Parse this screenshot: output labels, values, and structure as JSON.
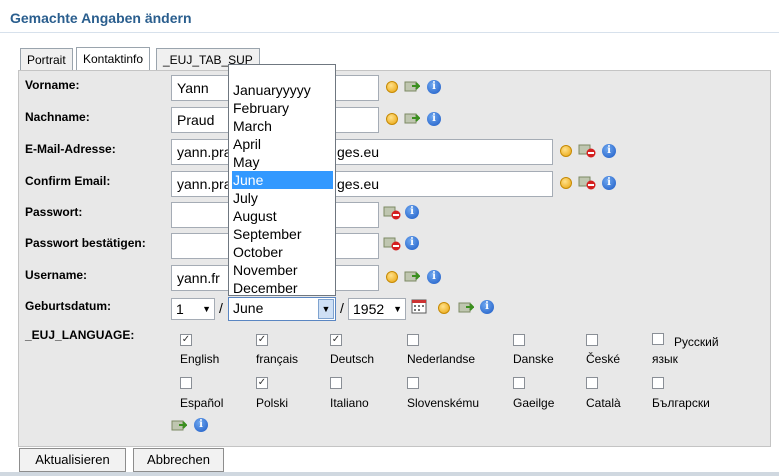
{
  "page": {
    "title": "Gemachte Angaben ändern"
  },
  "tabs": [
    {
      "label": "Portrait"
    },
    {
      "label": "Kontaktinfo"
    },
    {
      "label": "_EUJ_TAB_SUP"
    }
  ],
  "form": {
    "vorname": {
      "label": "Vorname:",
      "value": "Yann"
    },
    "nachname": {
      "label": "Nachname:",
      "value": "Praud"
    },
    "email": {
      "label": "E-Mail-Adresse:",
      "value": "yann.pra",
      "value_end": "ges.eu"
    },
    "confirm_email": {
      "label": "Confirm Email:",
      "value": "yann.pra",
      "value_end": "ges.eu"
    },
    "passwort": {
      "label": "Passwort:",
      "value": ""
    },
    "passwort_bestaetigen": {
      "label": "Passwort bestätigen:",
      "value": ""
    },
    "username": {
      "label": "Username:",
      "value": "yann.fr"
    },
    "geburtsdatum": {
      "label": "Geburtsdatum:",
      "day": "1",
      "month": "June",
      "year": "1952",
      "separator": "/"
    },
    "language": {
      "label": "_EUJ_LANGUAGE:",
      "options": [
        {
          "name": "English",
          "checked": true
        },
        {
          "name": "français",
          "checked": true
        },
        {
          "name": "Deutsch",
          "checked": true
        },
        {
          "name": "Nederlandse",
          "checked": false
        },
        {
          "name": "Danske",
          "checked": false
        },
        {
          "name": "České",
          "checked": false
        },
        {
          "name": "Русский язык",
          "checked": false
        },
        {
          "name": "Español",
          "checked": false
        },
        {
          "name": "Polski",
          "checked": true
        },
        {
          "name": "Italiano",
          "checked": false
        },
        {
          "name": "Slovenskému",
          "checked": false
        },
        {
          "name": "Gaeilge",
          "checked": false
        },
        {
          "name": "Català",
          "checked": false
        },
        {
          "name": "Български",
          "checked": false
        }
      ]
    }
  },
  "month_dropdown": {
    "options": [
      "Januaryyyyy",
      "February",
      "March",
      "April",
      "May",
      "June",
      "July",
      "August",
      "September",
      "October",
      "November",
      "December"
    ],
    "selected": "June"
  },
  "buttons": {
    "update": "Aktualisieren",
    "cancel": "Abbrechen"
  },
  "icons": {
    "warning": "warning-icon",
    "transfer": "transfer-icon",
    "delete": "remove-icon",
    "info": "info-icon",
    "calendar": "calendar-icon"
  },
  "colors": {
    "title": "#2a5e8e",
    "selection": "#3399ff",
    "panel": "#e8e8e8"
  }
}
